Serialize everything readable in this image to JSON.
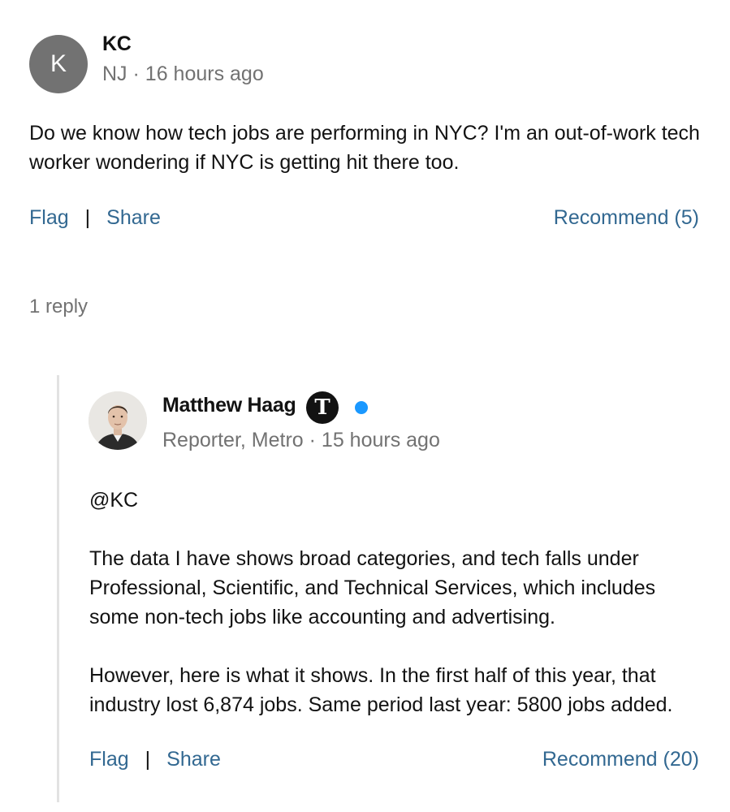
{
  "comment": {
    "avatar_letter": "K",
    "author": "KC",
    "location": "NJ",
    "separator": "·",
    "time": "16 hours ago",
    "body": "Do we know how tech jobs are performing in NYC? I'm an out-of-work tech worker wondering if NYC is getting hit there too.",
    "actions": {
      "flag": "Flag",
      "divider": "|",
      "share": "Share",
      "recommend": "Recommend (5)"
    }
  },
  "replies_label": "1 reply",
  "reply": {
    "author": "Matthew Haag",
    "badge_letter": "T",
    "badge_icon": "nyt-logo-icon",
    "verified_color": "#1a98ff",
    "role": "Reporter, Metro",
    "separator": "·",
    "time": "15 hours ago",
    "mention": "@KC",
    "paragraph_1": "The data I have shows broad categories, and tech falls under Professional, Scientific, and Technical Services, which includes some non-tech jobs like accounting and advertising.",
    "paragraph_2": "However, here is what it shows. In the first half of this year, that industry lost 6,874 jobs. Same period last year: 5800 jobs added.",
    "actions": {
      "flag": "Flag",
      "divider": "|",
      "share": "Share",
      "recommend": "Recommend (20)"
    }
  },
  "colors": {
    "link": "#326891",
    "muted": "#727272",
    "avatar_bg": "#727272",
    "thread_line": "#e2e2e2"
  }
}
